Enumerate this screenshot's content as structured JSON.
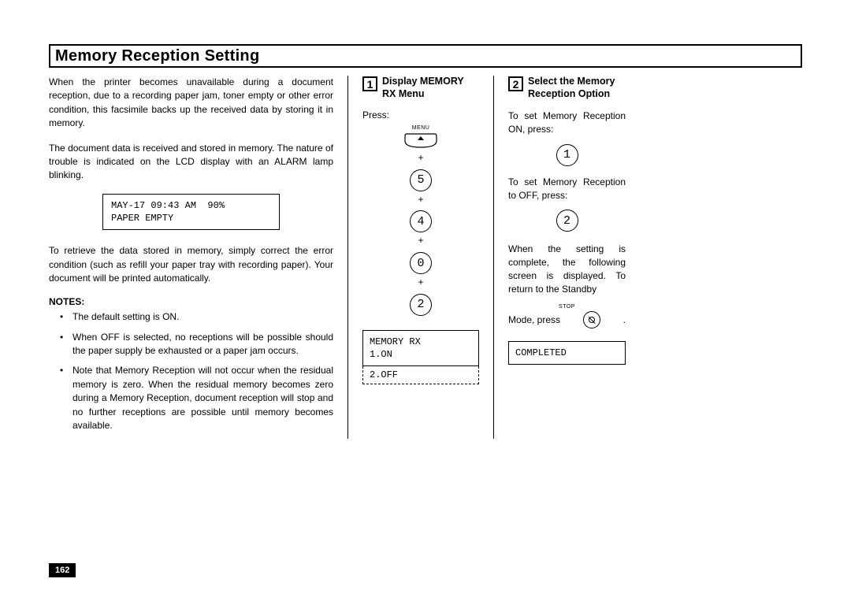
{
  "title": "Memory Reception Setting",
  "intro1": "When the printer becomes unavailable during a document reception, due to a recording paper jam, toner empty or other error condition, this facsimile backs up the received data by storing it in memory.",
  "intro2": "The document data is received and stored in memory. The nature of trouble is indicated on the LCD display with an ALARM lamp blinking.",
  "lcd_status": "MAY-17 09:43 AM  90%\nPAPER EMPTY",
  "intro3": "To retrieve the data stored in memory, simply correct the error condition (such as refill your paper tray with recording paper). Your document will be printed automatically.",
  "notes_head": "NOTES:",
  "notes": [
    "The default setting is ON.",
    "When OFF is selected, no receptions will be possible should the paper supply be exhausted or a paper jam occurs.",
    "Note that Memory Reception will not occur when the residual memory is zero. When the residual memory becomes zero during a Memory Reception, document reception will stop and no further receptions are possible until memory becomes available."
  ],
  "step1": {
    "num": "1",
    "title": "Display MEMORY RX Menu",
    "press": "Press:",
    "menu_label": "MENU",
    "keys": [
      "5",
      "4",
      "0",
      "2"
    ],
    "lcd_top": "MEMORY RX\n1.ON",
    "lcd_bottom": "2.OFF"
  },
  "step2": {
    "num": "2",
    "title": "Select the Memory Reception Option",
    "text_on": "To set Memory Reception ON, press:",
    "key_on": "1",
    "text_off": "To set Memory Reception to OFF, press:",
    "key_off": "2",
    "text_done": "When the setting is complete, the following screen is displayed. To return to the Standby",
    "stop_label": "STOP",
    "mode_press_pre": "Mode, press",
    "mode_press_post": ".",
    "lcd": "COMPLETED"
  },
  "page_num": "162"
}
